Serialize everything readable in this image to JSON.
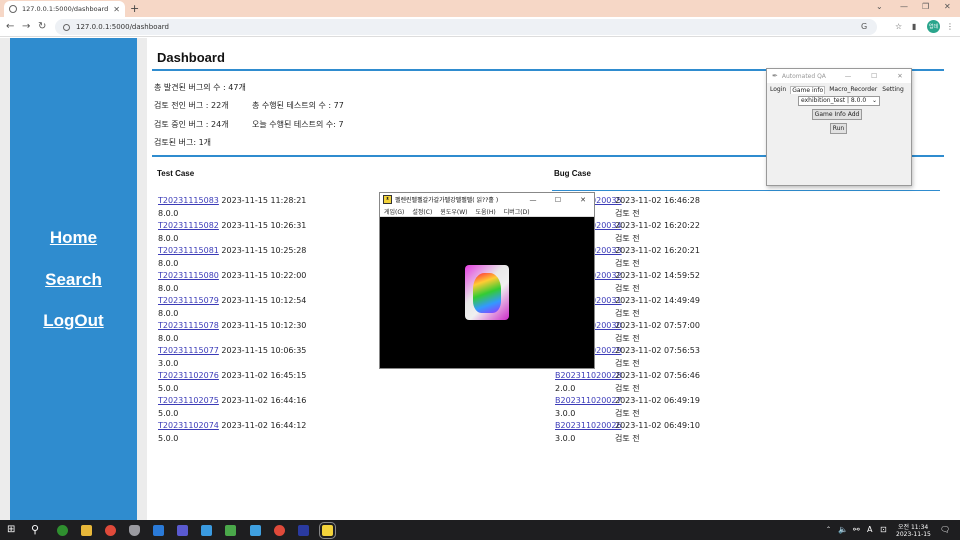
{
  "browser": {
    "tab_title": "127.0.0.1:5000/dashboard",
    "url": "127.0.0.1:5000/dashboard",
    "profile_initials": "업데"
  },
  "nav": {
    "home": "Home",
    "search": "Search",
    "logout": "LogOut"
  },
  "dashboard": {
    "title": "Dashboard",
    "stats": {
      "total_bugs": "총 발견된 버그의 수 : 47개",
      "pre_review": "검토 전인 버그 : 22개",
      "total_tests": "총 수행된 테스트의 수 : 77",
      "in_review": "검토 중인 버그 : 24개",
      "tests_today": "오늘 수행된 테스트의 수: 7",
      "reviewed": "검토된 버그: 1개"
    },
    "test_case_header": "Test Case",
    "bug_case_header": "Bug Case",
    "test_cases": [
      {
        "id": "T20231115083",
        "time": "2023-11-15 11:28:21",
        "version": "8.0.0"
      },
      {
        "id": "T20231115082",
        "time": "2023-11-15 10:26:31",
        "version": "8.0.0"
      },
      {
        "id": "T20231115081",
        "time": "2023-11-15 10:25:28",
        "version": "8.0.0"
      },
      {
        "id": "T20231115080",
        "time": "2023-11-15 10:22:00",
        "version": "8.0.0"
      },
      {
        "id": "T20231115079",
        "time": "2023-11-15 10:12:54",
        "version": "8.0.0"
      },
      {
        "id": "T20231115078",
        "time": "2023-11-15 10:12:30",
        "version": "8.0.0"
      },
      {
        "id": "T20231115077",
        "time": "2023-11-15 10:06:35",
        "version": "3.0.0"
      },
      {
        "id": "T20231102076",
        "time": "2023-11-02 16:45:15",
        "version": "5.0.0"
      },
      {
        "id": "T20231102075",
        "time": "2023-11-02 16:44:16",
        "version": "5.0.0"
      },
      {
        "id": "T20231102074",
        "time": "2023-11-02 16:44:12",
        "version": "5.0.0"
      }
    ],
    "bug_cases": [
      {
        "id": "B202311020035",
        "time": "2023-11-02 16:46:28",
        "version": "",
        "status": "검토 전"
      },
      {
        "id": "B202311020034",
        "time": "2023-11-02 16:20:22",
        "version": "",
        "status": "검토 전"
      },
      {
        "id": "B202311020033",
        "time": "2023-11-02 16:20:21",
        "version": "",
        "status": "검토 전"
      },
      {
        "id": "B202311020032",
        "time": "2023-11-02 14:59:52",
        "version": "",
        "status": "검토 전"
      },
      {
        "id": "B202311020031",
        "time": "2023-11-02 14:49:49",
        "version": "",
        "status": "검토 전"
      },
      {
        "id": "B202311020030",
        "time": "2023-11-02 07:57:00",
        "version": "",
        "status": "검토 전"
      },
      {
        "id": "B202311020029",
        "time": "2023-11-02 07:56:53",
        "version": "",
        "status": "검토 전"
      },
      {
        "id": "B202311020028",
        "time": "2023-11-02 07:56:46",
        "version": "2.0.0",
        "status": "검토 전"
      },
      {
        "id": "B202311020027",
        "time": "2023-11-02 06:49:19",
        "version": "3.0.0",
        "status": "검토 전"
      },
      {
        "id": "B202311020026",
        "time": "2023-11-02 06:49:10",
        "version": "3.0.0",
        "status": "검토 전"
      }
    ]
  },
  "qa_window": {
    "title": "Automated QA",
    "tabs": [
      "Login",
      "Game info",
      "Macro_Recorder",
      "Setting"
    ],
    "selected_tab": "Game info",
    "game_select_value": "exhibition_test | 8.0.0",
    "add_button": "Game Info Add",
    "run_button": "Run"
  },
  "game_window": {
    "title": "펠렌린펠펠갈가갈가펠강펠펠펠( 읽??홀 )",
    "menu": [
      "게임(G)",
      "설정(C)",
      "윈도우(W)",
      "도움(H)",
      "디버그(D)"
    ]
  },
  "taskbar": {
    "time": "오전 11:34",
    "date": "2023-11-15",
    "lang": "A"
  },
  "colors": {
    "accent": "#2f8ccf",
    "link": "#3b3bb8",
    "tabbar": "#f6d7c6"
  }
}
